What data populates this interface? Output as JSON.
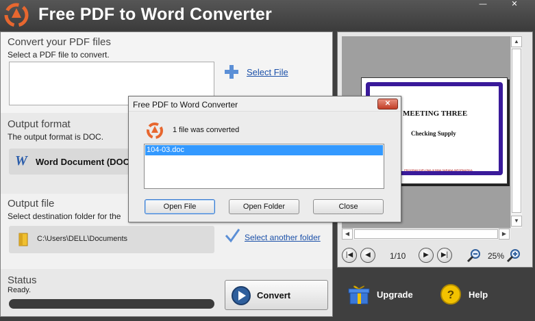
{
  "window": {
    "title": "Free PDF to Word Converter",
    "minimize_glyph": "—",
    "close_glyph": "✕"
  },
  "convert_section": {
    "title": "Convert your PDF files",
    "subtitle": "Select a PDF file to convert.",
    "select_file_link": "Select File"
  },
  "format_section": {
    "title": "Output format",
    "subtitle": "The output format is DOC.",
    "format_label": "Word Document (DOC",
    "format_icon": "W"
  },
  "outfile_section": {
    "title": "Output file",
    "subtitle": "Select destination folder for the",
    "path": "C:\\Users\\DELL\\Documents",
    "select_folder_link": "Select another folder"
  },
  "status_section": {
    "title": "Status",
    "status_text": "Ready.",
    "convert_button": "Convert"
  },
  "preview": {
    "slide_title": "MEETING THREE",
    "slide_subtitle": "Checking Supply",
    "slide_footer": "PROGRAM DIPLOMA III BINA SARANA INFORMATIKA",
    "page_indicator": "1/10",
    "zoom": "25%"
  },
  "bottom": {
    "upgrade_label": "Upgrade",
    "help_label": "Help"
  },
  "dialog": {
    "title": "Free PDF to Word Converter",
    "close_glyph": "✕",
    "message": "1 file was converted",
    "files": [
      "104-03.doc"
    ],
    "buttons": {
      "open_file": "Open File",
      "open_folder": "Open Folder",
      "close": "Close"
    }
  },
  "colors": {
    "titlebar": "#4a4a4a",
    "link": "#1a4fa8",
    "selection": "#3399ff",
    "slide_border": "#3a1a9a"
  }
}
